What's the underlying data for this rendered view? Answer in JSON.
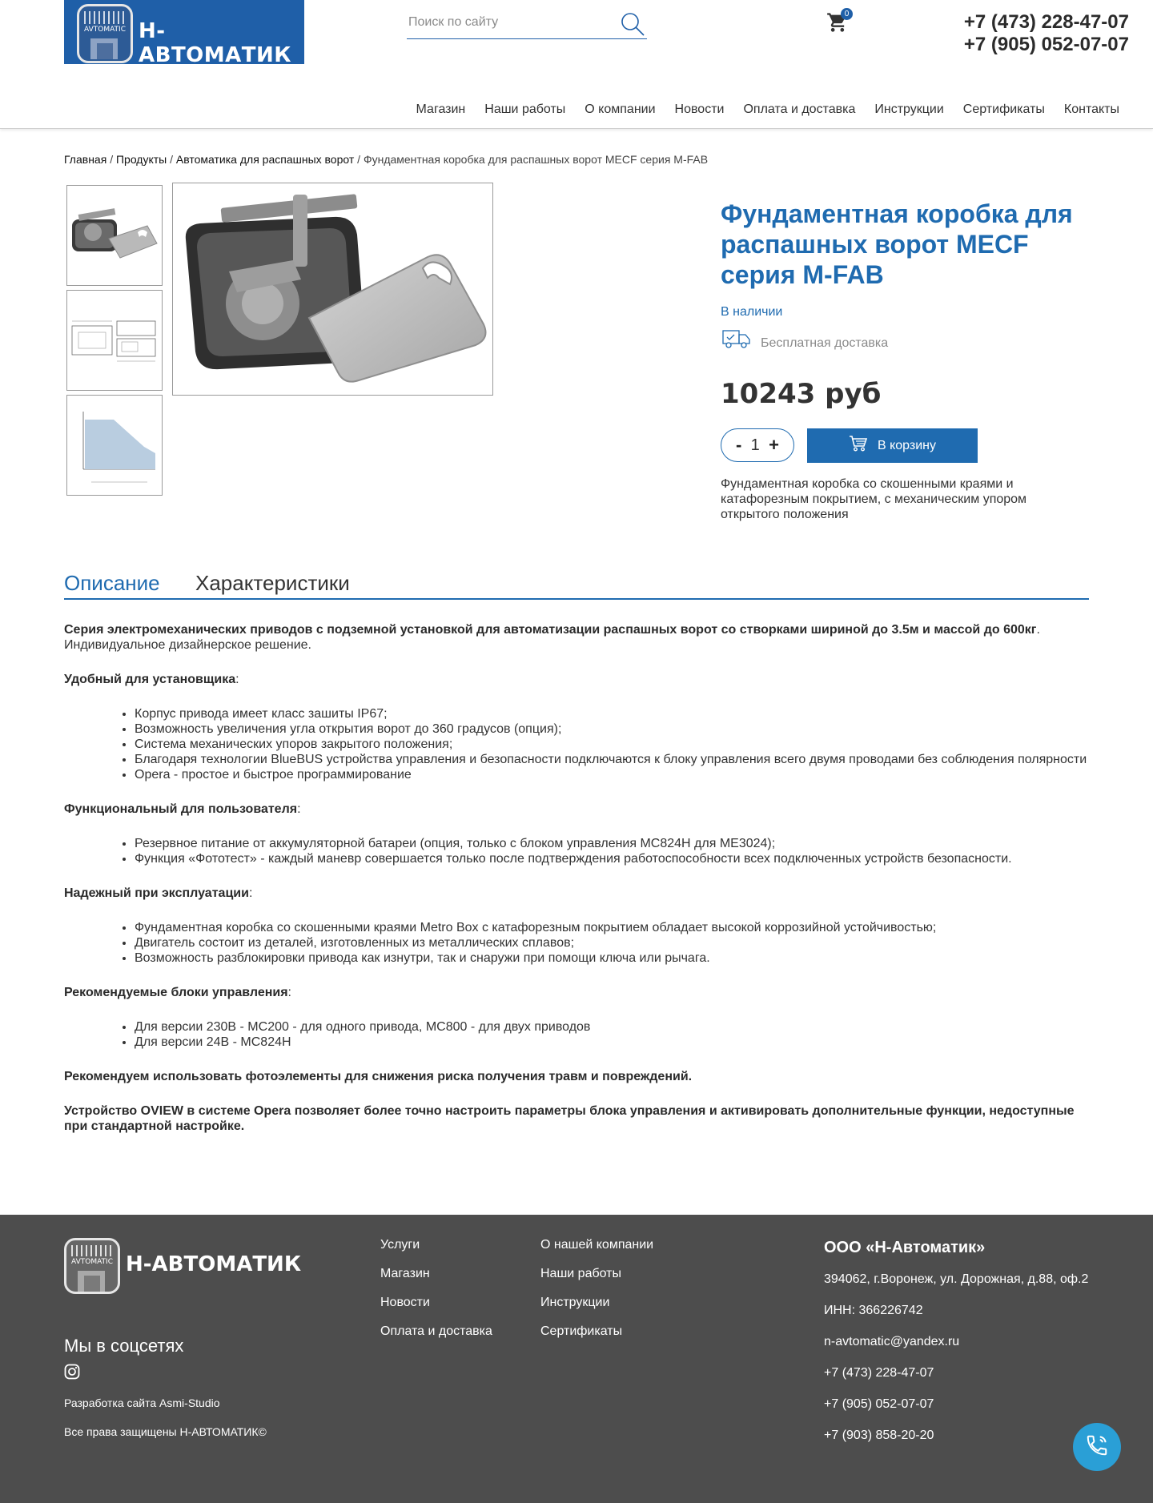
{
  "header": {
    "logo_text": "Н-АВТОМАТИК",
    "logo_badge_text": "AVTOMATIC",
    "search_placeholder": "Поиск по сайту",
    "cart_count": "0",
    "phones": [
      "+7 (473) 228-47-07",
      "+7 (905) 052-07-07"
    ],
    "nav": [
      "Магазин",
      "Наши работы",
      "О компании",
      "Новости",
      "Оплата и доставка",
      "Инструкции",
      "Сертификаты",
      "Контакты"
    ]
  },
  "breadcrumb": {
    "items": [
      "Главная",
      "Продукты",
      "Автоматика для распашных ворот"
    ],
    "separator": "/",
    "current": "Фундаментная коробка для распашных ворот MECF серия M-FAB"
  },
  "gallery": {
    "thumbnails": [
      "photo-thumbnail",
      "drawing-thumbnail",
      "chart-thumbnail"
    ]
  },
  "product": {
    "title": "Фундаментная коробка для распашных ворот MECF серия M-FAB",
    "stock": "В наличии",
    "delivery": "Бесплатная доставка",
    "price": "10243 руб",
    "quantity": "1",
    "qty_minus": "-",
    "qty_plus": "+",
    "add_to_cart": "В корзину",
    "short_description": "Фундаментная коробка со скошенными краями и катафорезным покрытием, с механическим упором открытого положения"
  },
  "tabs": [
    "Описание",
    "Характеристики"
  ],
  "description": {
    "intro_bold": "Серия электромеханических приводов с подземной установкой для автоматизации распашных ворот со створками шириной до 3.5м и массой до 600кг",
    "intro_rest": ". Индивидуальное дизайнерское решение.",
    "sections": [
      {
        "heading": "Удобный для установщика",
        "items": [
          "Корпус привода имеет класс зашиты IP67;",
          "Возможность увеличения угла открытия ворот до 360 градусов (опция);",
          "Система механических упоров закрытого положения;",
          "Благодаря технологии BlueBUS устройства управления и безопасности подключаются к блоку управления всего двумя проводами без соблюдения полярности",
          "Opera - простое и быстрое программирование"
        ]
      },
      {
        "heading": "Функциональный для пользователя",
        "items": [
          "Резервное питание от аккумуляторной батареи (опция, только с блоком управления MC824H для ME3024);",
          "Функция «Фототест» - каждый маневр совершается только после подтверждения работоспособности всех подключенных устройств безопасности."
        ]
      },
      {
        "heading": "Надежный при эксплуатации",
        "items": [
          "Фундаментная коробка со скошенными краями Metro Box с катафорезным покрытием обладает высокой коррозийной устойчивостью;",
          "Двигатель состоит из деталей, изготовленных из металлических сплавов;",
          "Возможность разблокировки привода как изнутри, так и снаружи при помощи ключа или рычага."
        ]
      },
      {
        "heading": "Рекомендуемые блоки управления",
        "items": [
          "Для версии 230В - MC200 - для одного привода, MC800 - для двух приводов",
          "Для версии 24В - MC824H"
        ]
      }
    ],
    "note1": "Рекомендуем использовать фотоэлементы для снижения риска получения травм и повреждений.",
    "note2": "Устройство OVIEW в системе Opera позволяет более точно настроить параметры блока управления и активировать дополнительные функции, недоступные при стандартной настройке."
  },
  "footer": {
    "logo_text": "Н-АВТОМАТИК",
    "logo_badge_text": "AVTOMATIC",
    "social_title": "Мы в соцсетях",
    "developer": "Разработка сайта Asmi-Studio",
    "rights": "Все права защищены Н-АВТОМАТИК©",
    "col1": [
      "Услуги",
      "Магазин",
      "Новости",
      "Оплата и доставка"
    ],
    "col2": [
      "О нашей компании",
      "Наши работы",
      "Инструкции",
      "Сертификаты"
    ],
    "company": {
      "name": "ООО «Н-Автоматик»",
      "address": "394062, г.Воронеж, ул. Дорожная, д.88, оф.2",
      "inn": "ИНН: 366226742",
      "email": "n-avtomatic@yandex.ru",
      "phones": [
        "+7 (473) 228-47-07",
        "+7 (905) 052-07-07",
        "+7 (903) 858-20-20"
      ]
    }
  },
  "colors": {
    "brand_blue": "#1f6bb0",
    "logo_blue": "#1f5fa8",
    "footer_bg": "#4d4d4d",
    "call_button": "#2a9fd6"
  }
}
